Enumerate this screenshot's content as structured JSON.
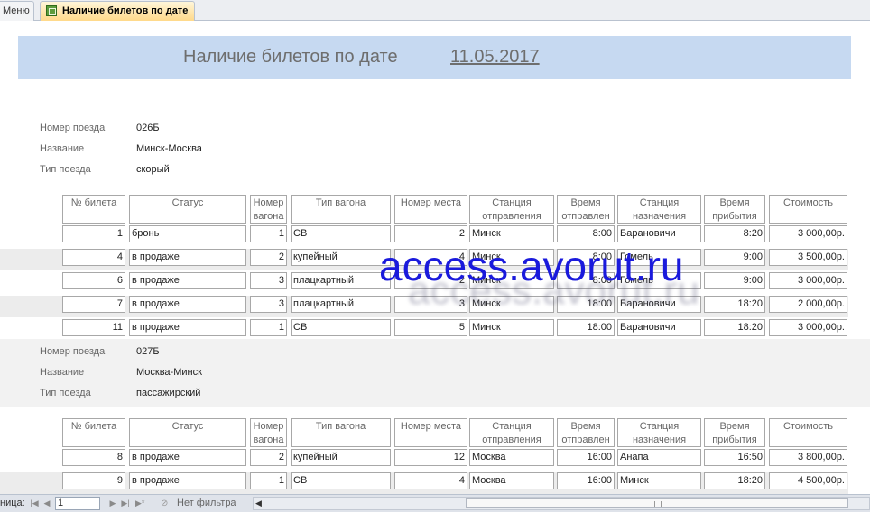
{
  "tabs": {
    "menu": "Меню",
    "active": "Наличие билетов по дате"
  },
  "header": {
    "title": "Наличие билетов по дате",
    "date": "11.05.2017"
  },
  "labels": {
    "train_number": "Номер поезда",
    "name": "Название",
    "train_type": "Тип поезда"
  },
  "columns": [
    "№ билета",
    "Статус",
    "Номер вагона",
    "Тип вагона",
    "Номер места",
    "Станция отправления",
    "Время отправлен",
    "Станция назначения",
    "Время прибытия",
    "Стоимость"
  ],
  "groups": [
    {
      "train_number": "026Б",
      "name": "Минск-Москва",
      "train_type": "скорый",
      "rows": [
        [
          "1",
          "бронь",
          "1",
          "СВ",
          "2",
          "Минск",
          "8:00",
          "Барановичи",
          "8:20",
          "3 000,00р."
        ],
        [
          "4",
          "в продаже",
          "2",
          "купейный",
          "4",
          "Минск",
          "8:00",
          "Гомель",
          "9:00",
          "3 500,00р."
        ],
        [
          "6",
          "в продаже",
          "3",
          "плацкартный",
          "2",
          "Минск",
          "8:00",
          "Гомель",
          "9:00",
          "3 000,00р."
        ],
        [
          "7",
          "в продаже",
          "3",
          "плацкартный",
          "3",
          "Минск",
          "18:00",
          "Барановичи",
          "18:20",
          "2 000,00р."
        ],
        [
          "11",
          "в продаже",
          "1",
          "СВ",
          "5",
          "Минск",
          "18:00",
          "Барановичи",
          "18:20",
          "3 000,00р."
        ]
      ]
    },
    {
      "train_number": "027Б",
      "name": "Москва-Минск",
      "train_type": "пассажирский",
      "rows": [
        [
          "8",
          "в продаже",
          "2",
          "купейный",
          "12",
          "Москва",
          "16:00",
          "Анапа",
          "16:50",
          "3 800,00р."
        ],
        [
          "9",
          "в продаже",
          "1",
          "СВ",
          "4",
          "Москва",
          "16:00",
          "Минск",
          "18:20",
          "4 500,00р."
        ]
      ]
    }
  ],
  "watermark": "access.avorut.ru",
  "statusbar": {
    "page_label": "ница:",
    "page_value": "1",
    "filter_label": "Нет фильтра"
  }
}
